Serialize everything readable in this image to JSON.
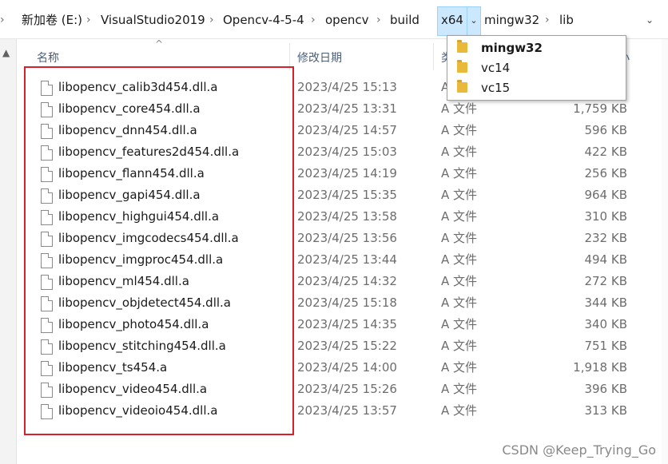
{
  "breadcrumb": {
    "items": [
      "新加卷 (E:)",
      "VisualStudio2019",
      "Opencv-4-5-4",
      "opencv",
      "build",
      "x64",
      "mingw32",
      "lib"
    ],
    "separator": "›",
    "dropdown_chevron": "⌄",
    "address_dropdown": "⌄"
  },
  "columns": {
    "name": "名称",
    "date_modified": "修改日期",
    "type": "类型",
    "size": "大小"
  },
  "files": [
    {
      "name": "libopencv_calib3d454.dll.a",
      "date": "2023/4/25 15:13",
      "type": "A 文件",
      "size": ""
    },
    {
      "name": "libopencv_core454.dll.a",
      "date": "2023/4/25 13:31",
      "type": "A 文件",
      "size": "1,759 KB"
    },
    {
      "name": "libopencv_dnn454.dll.a",
      "date": "2023/4/25 14:57",
      "type": "A 文件",
      "size": "596 KB"
    },
    {
      "name": "libopencv_features2d454.dll.a",
      "date": "2023/4/25 15:03",
      "type": "A 文件",
      "size": "422 KB"
    },
    {
      "name": "libopencv_flann454.dll.a",
      "date": "2023/4/25 14:19",
      "type": "A 文件",
      "size": "256 KB"
    },
    {
      "name": "libopencv_gapi454.dll.a",
      "date": "2023/4/25 15:35",
      "type": "A 文件",
      "size": "964 KB"
    },
    {
      "name": "libopencv_highgui454.dll.a",
      "date": "2023/4/25 13:58",
      "type": "A 文件",
      "size": "310 KB"
    },
    {
      "name": "libopencv_imgcodecs454.dll.a",
      "date": "2023/4/25 13:56",
      "type": "A 文件",
      "size": "232 KB"
    },
    {
      "name": "libopencv_imgproc454.dll.a",
      "date": "2023/4/25 13:44",
      "type": "A 文件",
      "size": "494 KB"
    },
    {
      "name": "libopencv_ml454.dll.a",
      "date": "2023/4/25 14:32",
      "type": "A 文件",
      "size": "272 KB"
    },
    {
      "name": "libopencv_objdetect454.dll.a",
      "date": "2023/4/25 15:18",
      "type": "A 文件",
      "size": "344 KB"
    },
    {
      "name": "libopencv_photo454.dll.a",
      "date": "2023/4/25 14:35",
      "type": "A 文件",
      "size": "340 KB"
    },
    {
      "name": "libopencv_stitching454.dll.a",
      "date": "2023/4/25 15:22",
      "type": "A 文件",
      "size": "751 KB"
    },
    {
      "name": "libopencv_ts454.a",
      "date": "2023/4/25 14:00",
      "type": "A 文件",
      "size": "1,918 KB"
    },
    {
      "name": "libopencv_video454.dll.a",
      "date": "2023/4/25 15:26",
      "type": "A 文件",
      "size": "396 KB"
    },
    {
      "name": "libopencv_videoio454.dll.a",
      "date": "2023/4/25 13:57",
      "type": "A 文件",
      "size": "313 KB"
    }
  ],
  "popup": {
    "items": [
      {
        "label": "mingw32",
        "selected": true
      },
      {
        "label": "vc14",
        "selected": false
      },
      {
        "label": "vc15",
        "selected": false
      }
    ]
  },
  "watermark": "CSDN @Keep_Trying_Go",
  "colors": {
    "selection_bg": "#cce8ff",
    "highlight_border": "#d9202a",
    "folder": "#e8b93b",
    "header_text": "#4c607a"
  },
  "icons": {
    "file": "file-icon",
    "folder": "folder-icon",
    "sort": "sort-up-icon"
  }
}
